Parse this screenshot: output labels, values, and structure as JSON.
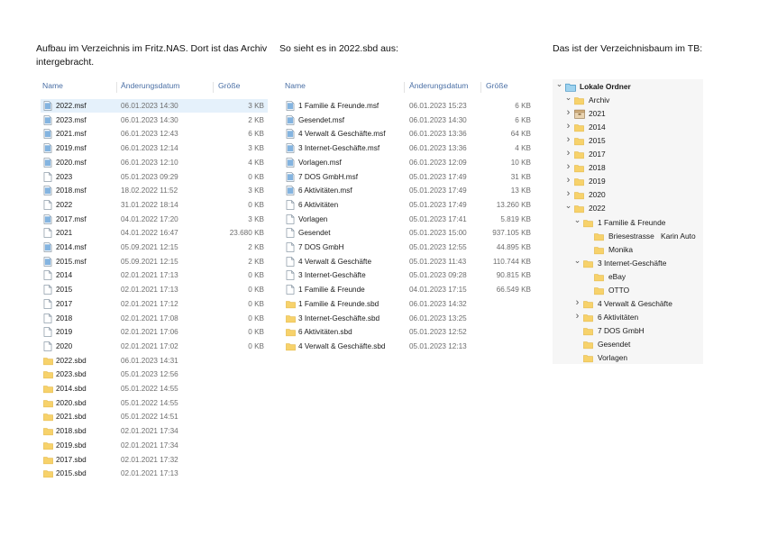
{
  "captions": {
    "left": "Aufbau im Verzeichnis im Fritz.NAS. Dort ist das Archiv",
    "left2": "intergebracht.",
    "middle": "So sieht es in 2022.sbd aus:",
    "right": "Das ist der Verzeichnisbaum im TB:"
  },
  "columns": {
    "name": "Name",
    "date": "Änderungsdatum",
    "size": "Größe"
  },
  "left_pane": [
    {
      "name": "2022.msf",
      "date": "06.01.2023 14:30",
      "size": "3 KB",
      "type": "msf",
      "selected": true
    },
    {
      "name": "2023.msf",
      "date": "06.01.2023 14:30",
      "size": "2 KB",
      "type": "msf"
    },
    {
      "name": "2021.msf",
      "date": "06.01.2023 12:43",
      "size": "6 KB",
      "type": "msf"
    },
    {
      "name": "2019.msf",
      "date": "06.01.2023 12:14",
      "size": "3 KB",
      "type": "msf"
    },
    {
      "name": "2020.msf",
      "date": "06.01.2023 12:10",
      "size": "4 KB",
      "type": "msf"
    },
    {
      "name": "2023",
      "date": "05.01.2023 09:29",
      "size": "0 KB",
      "type": "file"
    },
    {
      "name": "2018.msf",
      "date": "18.02.2022 11:52",
      "size": "3 KB",
      "type": "msf"
    },
    {
      "name": "2022",
      "date": "31.01.2022 18:14",
      "size": "0 KB",
      "type": "file"
    },
    {
      "name": "2017.msf",
      "date": "04.01.2022 17:20",
      "size": "3 KB",
      "type": "msf"
    },
    {
      "name": "2021",
      "date": "04.01.2022 16:47",
      "size": "23.680 KB",
      "type": "file"
    },
    {
      "name": "2014.msf",
      "date": "05.09.2021 12:15",
      "size": "2 KB",
      "type": "msf"
    },
    {
      "name": "2015.msf",
      "date": "05.09.2021 12:15",
      "size": "2 KB",
      "type": "msf"
    },
    {
      "name": "2014",
      "date": "02.01.2021 17:13",
      "size": "0 KB",
      "type": "file"
    },
    {
      "name": "2015",
      "date": "02.01.2021 17:13",
      "size": "0 KB",
      "type": "file"
    },
    {
      "name": "2017",
      "date": "02.01.2021 17:12",
      "size": "0 KB",
      "type": "file"
    },
    {
      "name": "2018",
      "date": "02.01.2021 17:08",
      "size": "0 KB",
      "type": "file"
    },
    {
      "name": "2019",
      "date": "02.01.2021 17:06",
      "size": "0 KB",
      "type": "file"
    },
    {
      "name": "2020",
      "date": "02.01.2021 17:02",
      "size": "0 KB",
      "type": "file"
    },
    {
      "name": "2022.sbd",
      "date": "06.01.2023 14:31",
      "size": "",
      "type": "folder"
    },
    {
      "name": "2023.sbd",
      "date": "05.01.2023 12:56",
      "size": "",
      "type": "folder"
    },
    {
      "name": "2014.sbd",
      "date": "05.01.2022 14:55",
      "size": "",
      "type": "folder"
    },
    {
      "name": "2020.sbd",
      "date": "05.01.2022 14:55",
      "size": "",
      "type": "folder"
    },
    {
      "name": "2021.sbd",
      "date": "05.01.2022 14:51",
      "size": "",
      "type": "folder"
    },
    {
      "name": "2018.sbd",
      "date": "02.01.2021 17:34",
      "size": "",
      "type": "folder"
    },
    {
      "name": "2019.sbd",
      "date": "02.01.2021 17:34",
      "size": "",
      "type": "folder"
    },
    {
      "name": "2017.sbd",
      "date": "02.01.2021 17:32",
      "size": "",
      "type": "folder"
    },
    {
      "name": "2015.sbd",
      "date": "02.01.2021 17:13",
      "size": "",
      "type": "folder"
    }
  ],
  "middle_pane": [
    {
      "name": "1 Familie & Freunde.msf",
      "date": "06.01.2023 15:23",
      "size": "6 KB",
      "type": "msf"
    },
    {
      "name": "Gesendet.msf",
      "date": "06.01.2023 14:30",
      "size": "6 KB",
      "type": "msf"
    },
    {
      "name": "4 Verwalt & Geschäfte.msf",
      "date": "06.01.2023 13:36",
      "size": "64 KB",
      "type": "msf"
    },
    {
      "name": "3 Internet-Geschäfte.msf",
      "date": "06.01.2023 13:36",
      "size": "4 KB",
      "type": "msf"
    },
    {
      "name": "Vorlagen.msf",
      "date": "06.01.2023 12:09",
      "size": "10 KB",
      "type": "msf"
    },
    {
      "name": "7 DOS GmbH.msf",
      "date": "05.01.2023 17:49",
      "size": "31 KB",
      "type": "msf"
    },
    {
      "name": "6 Aktivitäten.msf",
      "date": "05.01.2023 17:49",
      "size": "13 KB",
      "type": "msf"
    },
    {
      "name": "6 Aktivitäten",
      "date": "05.01.2023 17:49",
      "size": "13.260 KB",
      "type": "file"
    },
    {
      "name": "Vorlagen",
      "date": "05.01.2023 17:41",
      "size": "5.819 KB",
      "type": "file"
    },
    {
      "name": "Gesendet",
      "date": "05.01.2023 15:00",
      "size": "937.105 KB",
      "type": "file"
    },
    {
      "name": "7 DOS GmbH",
      "date": "05.01.2023 12:55",
      "size": "44.895 KB",
      "type": "file"
    },
    {
      "name": "4 Verwalt & Geschäfte",
      "date": "05.01.2023 11:43",
      "size": "110.744 KB",
      "type": "file"
    },
    {
      "name": "3 Internet-Geschäfte",
      "date": "05.01.2023 09:28",
      "size": "90.815 KB",
      "type": "file"
    },
    {
      "name": "1 Familie & Freunde",
      "date": "04.01.2023 17:15",
      "size": "66.549 KB",
      "type": "file"
    },
    {
      "name": "1 Familie & Freunde.sbd",
      "date": "06.01.2023 14:32",
      "size": "",
      "type": "folder"
    },
    {
      "name": "3 Internet-Geschäfte.sbd",
      "date": "06.01.2023 13:25",
      "size": "",
      "type": "folder"
    },
    {
      "name": "6 Aktivitäten.sbd",
      "date": "05.01.2023 12:52",
      "size": "",
      "type": "folder"
    },
    {
      "name": "4 Verwalt & Geschäfte.sbd",
      "date": "05.01.2023 12:13",
      "size": "",
      "type": "folder"
    }
  ],
  "tree": [
    {
      "label": "Lokale Ordner",
      "chevron": "down",
      "icon": "local",
      "bold": true,
      "depth": 0
    },
    {
      "label": "Archiv",
      "chevron": "down",
      "icon": "folder",
      "depth": 1
    },
    {
      "label": "2021",
      "chevron": "right",
      "icon": "archive",
      "depth": 2
    },
    {
      "label": "2014",
      "chevron": "right",
      "icon": "folder",
      "depth": 2
    },
    {
      "label": "2015",
      "chevron": "right",
      "icon": "folder",
      "depth": 2
    },
    {
      "label": "2017",
      "chevron": "right",
      "icon": "folder",
      "depth": 2
    },
    {
      "label": "2018",
      "chevron": "right",
      "icon": "folder",
      "depth": 2
    },
    {
      "label": "2019",
      "chevron": "right",
      "icon": "folder",
      "depth": 2
    },
    {
      "label": "2020",
      "chevron": "right",
      "icon": "folder",
      "depth": 2
    },
    {
      "label": "2022",
      "chevron": "down",
      "icon": "folder",
      "depth": 2
    },
    {
      "label": "1 Familie & Freunde",
      "chevron": "down",
      "icon": "folder",
      "depth": 3
    },
    {
      "label": "Briesestrasse",
      "label2": "Karin Auto",
      "chevron": "",
      "icon": "folder",
      "depth": 4
    },
    {
      "label": "Monika",
      "chevron": "",
      "icon": "folder",
      "depth": 4
    },
    {
      "label": "3 Internet-Geschäfte",
      "chevron": "down",
      "icon": "folder",
      "depth": 3
    },
    {
      "label": "eBay",
      "chevron": "",
      "icon": "folder",
      "depth": 4
    },
    {
      "label": "OTTO",
      "chevron": "",
      "icon": "folder",
      "depth": 4
    },
    {
      "label": "4 Verwalt & Geschäfte",
      "chevron": "right",
      "icon": "folder",
      "depth": 3
    },
    {
      "label": "6 Aktivitäten",
      "chevron": "right",
      "icon": "folder",
      "depth": 3
    },
    {
      "label": "7 DOS GmbH",
      "chevron": "",
      "icon": "folder",
      "depth": 3
    },
    {
      "label": "Gesendet",
      "chevron": "",
      "icon": "folder",
      "depth": 3
    },
    {
      "label": "Vorlagen",
      "chevron": "",
      "icon": "folder",
      "depth": 3
    }
  ],
  "colors": {
    "folder": "#f7d26b",
    "folder_dark": "#e2b43d",
    "msf": "#5b9bd5",
    "header_text": "#4a6fa5",
    "selection": "#e5f1fb"
  }
}
